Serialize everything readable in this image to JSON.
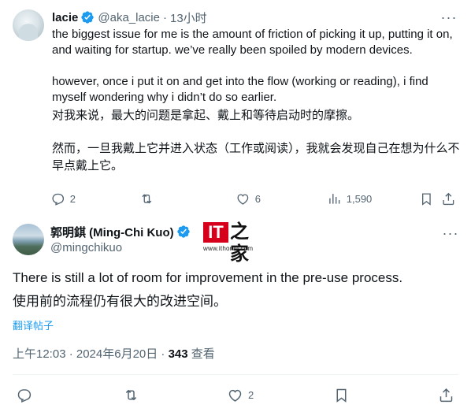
{
  "reply": {
    "name": "lacie",
    "handle": "@aka_lacie",
    "time": "13小时",
    "para1": "the biggest issue for me is the amount of friction of picking it up, putting it on, and waiting for startup. we’ve really been spoiled by modern devices.",
    "para2": "however, once i put it on and get into the flow (working or reading), i find myself wondering why i didn’t do so earlier.",
    "para3": "对我来说，最大的问题是拿起、戴上和等待启动时的摩擦。",
    "para4": "然而，一旦我戴上它并进入状态（工作或阅读），我就会发现自己在想为什么不早点戴上它。",
    "replies": "2",
    "likes": "6",
    "views": "1,590"
  },
  "main": {
    "name": "郭明錤 (Ming-Chi Kuo)",
    "handle": "@mingchikuo",
    "logo_text": "IT",
    "logo_zh": "之家",
    "logo_url": "www.ithome.com",
    "text_en": "There is still a lot of room for improvement in the pre-use process.",
    "text_zh": "使用前的流程仍有很大的改进空间。",
    "translate": "翻译帖子",
    "meta_time": "上午12:03 · 2024年6月20日 · ",
    "meta_views_count": "343",
    "meta_views_label": " 查看",
    "likes": "2"
  },
  "colors": {
    "verified": "#1d9bf0",
    "secondary_text": "#536471",
    "link": "#1d9bf0",
    "logo_red": "#d6001c"
  },
  "icons": [
    "verified-badge-icon",
    "more-icon",
    "reply-icon",
    "retweet-icon",
    "like-icon",
    "views-icon",
    "bookmark-icon",
    "share-icon"
  ]
}
